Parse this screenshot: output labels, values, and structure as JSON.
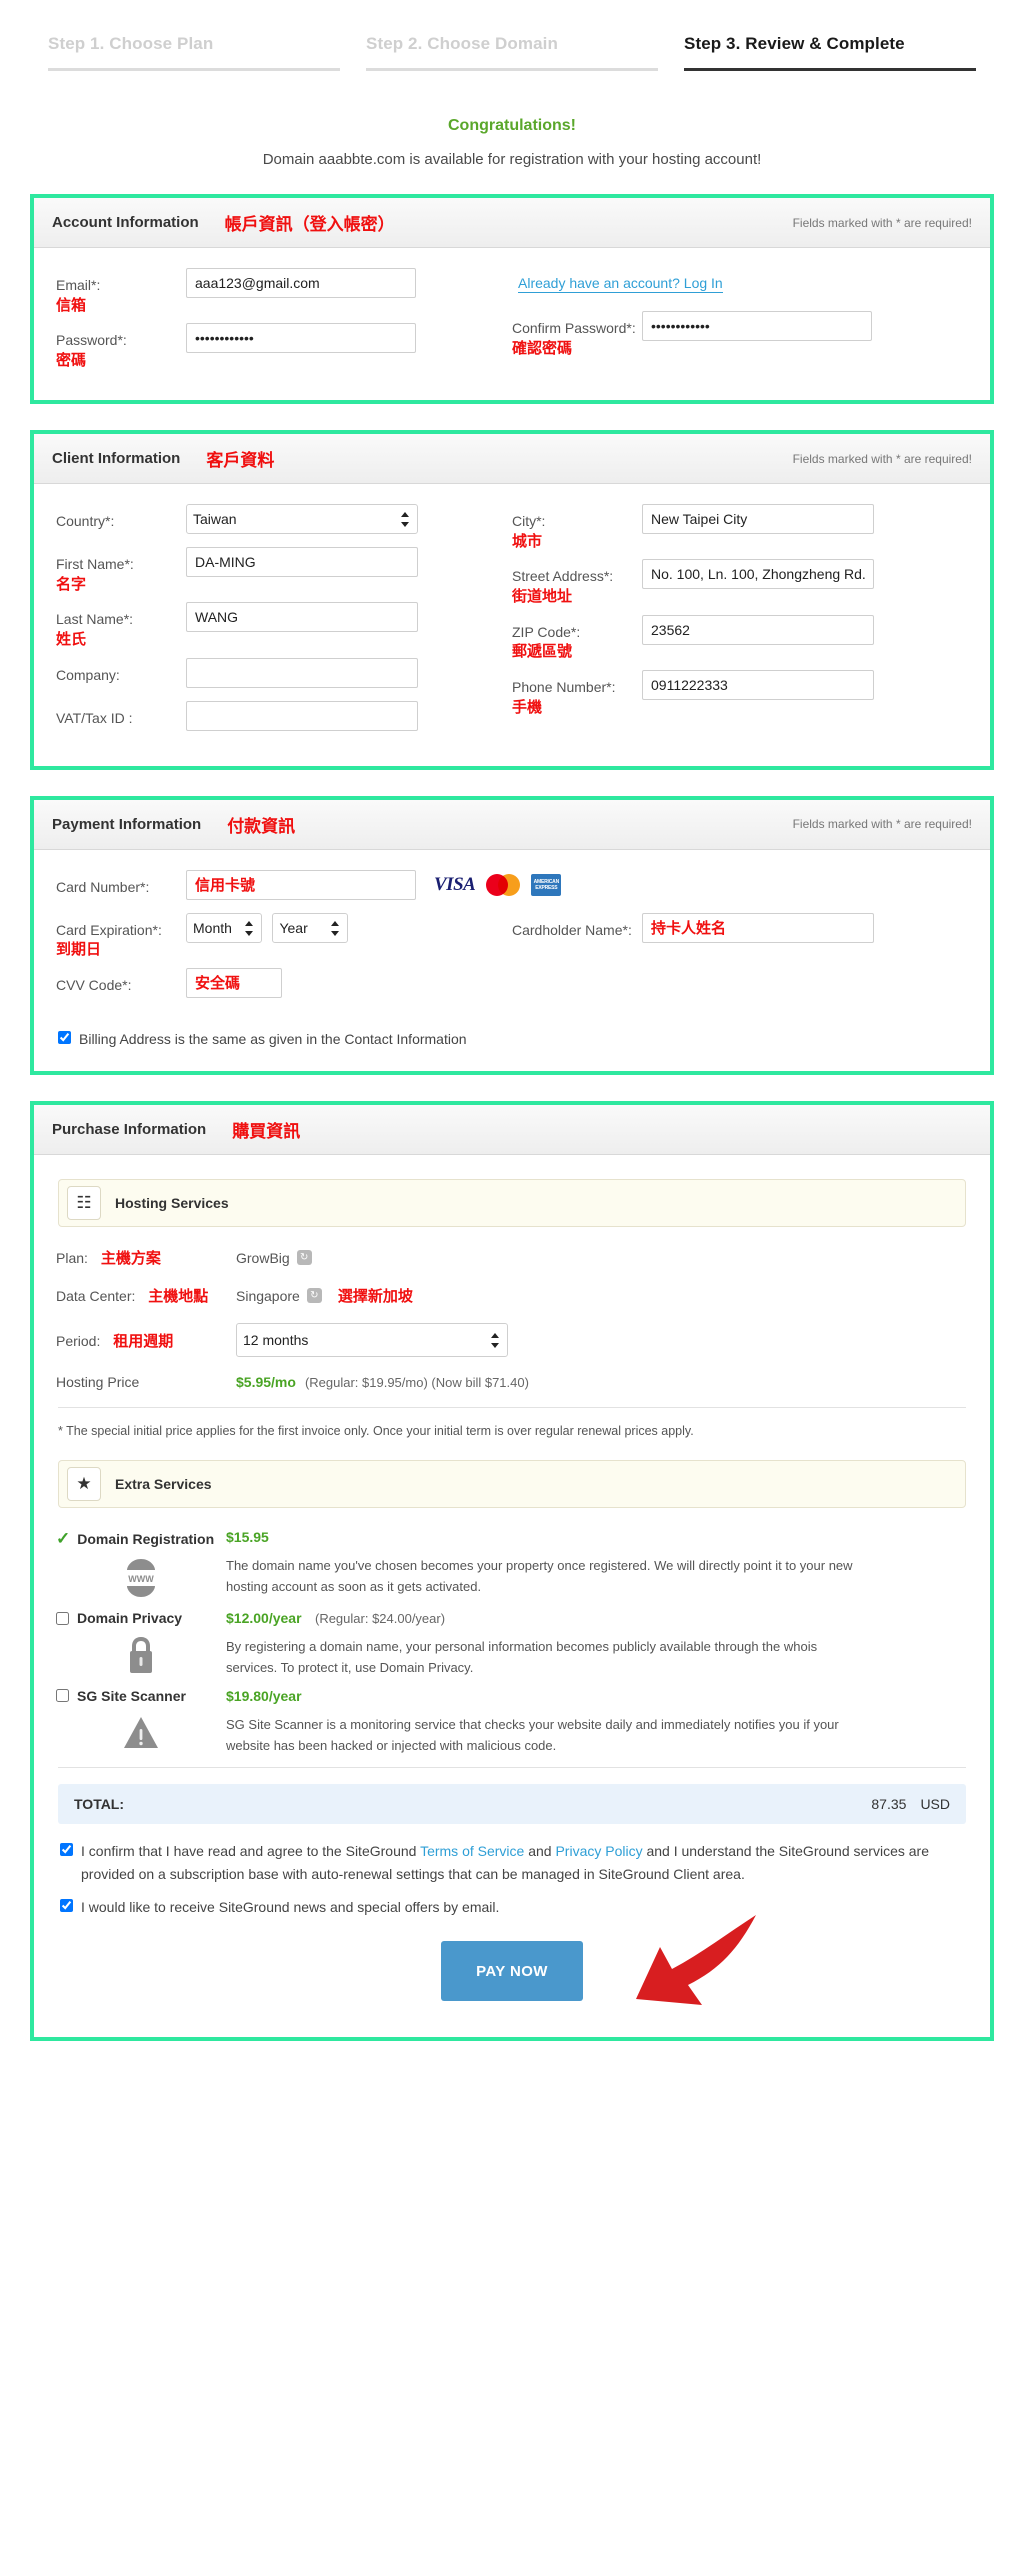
{
  "steps": [
    {
      "label": "Step 1. Choose Plan",
      "active": false
    },
    {
      "label": "Step 2. Choose Domain",
      "active": false
    },
    {
      "label": "Step 3. Review & Complete",
      "active": true
    }
  ],
  "intro": {
    "congrats": "Congratulations!",
    "availability": "Domain aaabbte.com is available for registration with your hosting account!"
  },
  "required_note": "Fields marked with * are required!",
  "account": {
    "title": "Account Information",
    "title_zh": "帳戶資訊（登入帳密）",
    "email_label": "Email*:",
    "email_zh": "信箱",
    "email_value": "aaa123@gmail.com",
    "login_link": "Already have an account? Log In",
    "password_label": "Password*:",
    "password_zh": "密碼",
    "password_value": "••••••••••••",
    "confirm_label": "Confirm Password*:",
    "confirm_zh": "確認密碼",
    "confirm_value": "••••••••••••"
  },
  "client": {
    "title": "Client Information",
    "title_zh": "客戶資料",
    "country_label": "Country*:",
    "country_value": "Taiwan",
    "first_name_label": "First Name*:",
    "first_name_zh": "名字",
    "first_name_value": "DA-MING",
    "last_name_label": "Last Name*:",
    "last_name_zh": "姓氏",
    "last_name_value": "WANG",
    "company_label": "Company:",
    "company_value": "",
    "vat_label": "VAT/Tax ID :",
    "vat_value": "",
    "city_label": "City*:",
    "city_zh": "城市",
    "city_value": "New Taipei City",
    "street_label": "Street Address*:",
    "street_zh": "街道地址",
    "street_value": "No. 100, Ln. 100, Zhongzheng Rd.",
    "zip_label": "ZIP Code*:",
    "zip_zh": "郵遞區號",
    "zip_value": "23562",
    "phone_label": "Phone Number*:",
    "phone_zh": "手機",
    "phone_value": "0911222333"
  },
  "payment": {
    "title": "Payment Information",
    "title_zh": "付款資訊",
    "card_number_label": "Card Number*:",
    "card_number_value": "信用卡號",
    "card_logos": [
      "visa-logo",
      "mastercard-logo",
      "amex-logo"
    ],
    "amex_text": "AMERICAN EXPRESS",
    "expiration_label": "Card Expiration*:",
    "expiration_zh": "到期日",
    "month_value": "Month",
    "year_value": "Year",
    "cardholder_label": "Cardholder Name*:",
    "cardholder_value": "持卡人姓名",
    "cvv_label": "CVV Code*:",
    "cvv_value": "安全碼",
    "billing_same": "Billing Address is the same as given in the Contact Information"
  },
  "purchase": {
    "title": "Purchase Information",
    "title_zh": "購買資訊",
    "hosting_services_label": "Hosting Services",
    "plan_label": "Plan:",
    "plan_zh": "主機方案",
    "plan_value": "GrowBig",
    "datacenter_label": "Data Center:",
    "datacenter_zh": "主機地點",
    "datacenter_value": "Singapore",
    "datacenter_note_zh": "選擇新加坡",
    "period_label": "Period:",
    "period_zh": "租用週期",
    "period_value": "12 months",
    "hosting_price_label": "Hosting Price",
    "hosting_price_value": "$5.95/mo",
    "hosting_price_regular": "(Regular: $19.95/mo) (Now bill $71.40)",
    "fineprint": "* The special initial price applies for the first invoice only. Once your initial term is over regular renewal prices apply.",
    "extra_services_label": "Extra Services",
    "extras": [
      {
        "name": "Domain Registration",
        "price": "$15.95",
        "regular": "",
        "checked": true,
        "icon": "www-globe-icon",
        "description": "The domain name you've chosen becomes your property once registered. We will directly point it to your new hosting account as soon as it gets activated."
      },
      {
        "name": "Domain Privacy",
        "price": "$12.00/year",
        "regular": "(Regular: $24.00/year)",
        "checked": false,
        "icon": "lock-icon",
        "description": "By registering a domain name, your personal information becomes publicly available through the whois services. To protect it, use Domain Privacy."
      },
      {
        "name": "SG Site Scanner",
        "price": "$19.80/year",
        "regular": "",
        "checked": false,
        "icon": "warning-triangle-icon",
        "description": "SG Site Scanner is a monitoring service that checks your website daily and immediately notifies you if your website has been hacked or injected with malicious code."
      }
    ],
    "total_label": "TOTAL:",
    "total_amount": "87.35",
    "total_currency": "USD",
    "terms_checked": true,
    "terms_parts": {
      "p1": "I confirm that I have read and agree to the SiteGround ",
      "tos": "Terms of Service",
      "p2": " and ",
      "privacy": "Privacy Policy",
      "p3": " and I understand the SiteGround services are provided on a subscription base with auto-renewal settings that can be managed in SiteGround Client area."
    },
    "newsletter_checked": true,
    "newsletter_text": "I would like to receive SiteGround news and special offers by email.",
    "pay_button": "PAY NOW"
  },
  "colors": {
    "panel_border": "#2ee89f",
    "annotation_red": "#f01010",
    "price_green": "#4aa425",
    "link_blue": "#2f9fd6",
    "pay_button": "#4a98cc",
    "arrow_red": "#d81e20",
    "total_bg": "#e9f2fb"
  }
}
